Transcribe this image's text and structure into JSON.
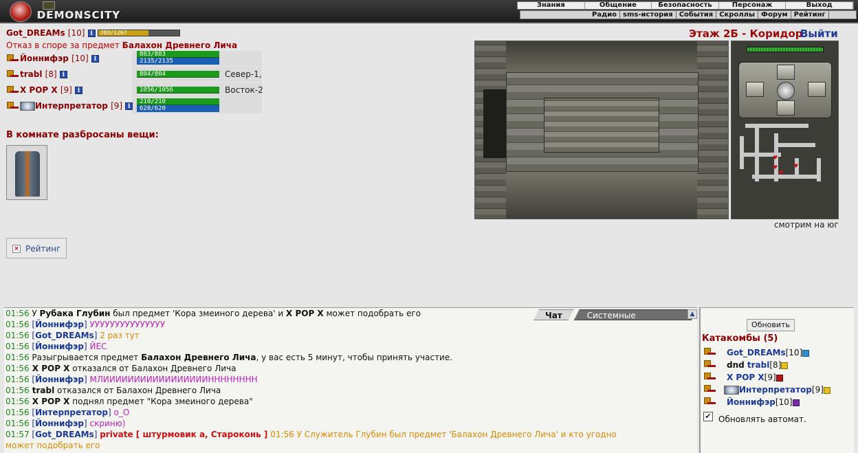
{
  "header": {
    "logo_text": "DEMONSCITY",
    "menu_top": [
      "Знания",
      "Общение",
      "Безопасность",
      "Персонаж",
      "Выход"
    ],
    "menu_bottom": [
      "Радио",
      "sms-история",
      "События",
      "Скроллы",
      "Форум",
      "Рейтинг"
    ]
  },
  "me": {
    "name": "Got_DREAMs",
    "level": "[10]",
    "exp_text": "783/1267",
    "exp_fraction": 0.62
  },
  "refusal": {
    "prefix": "Отказ в споре за предмет",
    "item": "Балахон Древнего Лича"
  },
  "players": [
    {
      "name": "Йоннифэр",
      "level": "[10]",
      "hp": "883/883",
      "mp": "2135/2135",
      "loc": "",
      "avatar": false
    },
    {
      "name": "trabl",
      "level": "[8]",
      "hp": "804/804",
      "mp": "",
      "loc": "Север-1,",
      "avatar": false
    },
    {
      "name": "X POP X",
      "level": "[9]",
      "hp": "1056/1056",
      "mp": "",
      "loc": "Восток-2",
      "avatar": false
    },
    {
      "name": "Интерпретатор",
      "level": "[9]",
      "hp": "210/210",
      "mp": "620/620",
      "loc": "",
      "avatar": true
    }
  ],
  "items_title": "В комнате разбросаны вещи:",
  "rating_button": "Рейтинг",
  "location": {
    "title": "Этаж 2Б - Коридор",
    "exit": "Выйти",
    "look": "смотрим на юг"
  },
  "chat": {
    "tab_chat": "Чат",
    "tab_system": "Системные сообщения",
    "lines": [
      {
        "t": "01:56",
        "parts": [
          [
            "dark",
            " У "
          ],
          [
            "blk",
            "Рубака Глубин"
          ],
          [
            "dark",
            " был предмет 'Кора змеиного дерева' и "
          ],
          [
            "blk",
            "X POP X"
          ],
          [
            "dark",
            " может подобрать его"
          ]
        ]
      },
      {
        "t": "01:56",
        "parts": [
          [
            "br",
            " ["
          ],
          [
            "nm",
            "Йоннифэр"
          ],
          [
            "br",
            "] "
          ],
          [
            "pink",
            "УУУУУУУУУУУУУУУ"
          ]
        ]
      },
      {
        "t": "01:56",
        "parts": [
          [
            "br",
            " ["
          ],
          [
            "nm",
            "Got_DREAMs"
          ],
          [
            "br",
            "] "
          ],
          [
            "orange",
            "2 раз тут"
          ]
        ]
      },
      {
        "t": "01:56",
        "parts": [
          [
            "br",
            " ["
          ],
          [
            "nm",
            "Йоннифэр"
          ],
          [
            "br",
            "] "
          ],
          [
            "pink",
            "ЙЕС"
          ]
        ]
      },
      {
        "t": "01:56",
        "parts": [
          [
            "dark",
            " Разыгрывается предмет "
          ],
          [
            "blk",
            "Балахон Древнего Лича"
          ],
          [
            "dark",
            ", у вас есть 5 минут, чтобы принять участие."
          ]
        ]
      },
      {
        "t": "01:56",
        "parts": [
          [
            "blk",
            " X POP X"
          ],
          [
            "dark",
            " отказался от Балахон Древнего Лича"
          ]
        ]
      },
      {
        "t": "01:56",
        "parts": [
          [
            "br",
            " ["
          ],
          [
            "nm",
            "Йоннифэр"
          ],
          [
            "br",
            "] "
          ],
          [
            "pink",
            "МЛИИИИИИИИИИИИИИИИИНННННННН"
          ]
        ]
      },
      {
        "t": "01:56",
        "parts": [
          [
            "blk",
            " trabl"
          ],
          [
            "dark",
            " отказался от Балахон Древнего Лича"
          ]
        ]
      },
      {
        "t": "01:56",
        "parts": [
          [
            "blk",
            " X POP X"
          ],
          [
            "dark",
            " поднял предмет \"Кора змеиного дерева\""
          ]
        ]
      },
      {
        "t": "01:56",
        "parts": [
          [
            "br",
            " ["
          ],
          [
            "nm",
            "Интерпретатор"
          ],
          [
            "br",
            "] "
          ],
          [
            "pink",
            "о_О"
          ]
        ]
      },
      {
        "t": "01:56",
        "parts": [
          [
            "br",
            " ["
          ],
          [
            "nm",
            "Йоннифэр"
          ],
          [
            "br",
            "] "
          ],
          [
            "pink",
            "скриню)"
          ]
        ]
      },
      {
        "t": "01:57",
        "parts": [
          [
            "br",
            " ["
          ],
          [
            "nm",
            "Got_DREAMs"
          ],
          [
            "br",
            "] "
          ],
          [
            "red",
            "private [ штурмовик а, Староконь ]"
          ],
          [
            "orange",
            " 01:56 У Служитель Глубин был предмет 'Балахон Древнего Лича' и кто угодно"
          ]
        ]
      },
      {
        "t": "",
        "parts": [
          [
            "orange",
            "может подобрать его"
          ]
        ]
      }
    ]
  },
  "userpanel": {
    "refresh": "Обновить",
    "room": "Катакомбы (5)",
    "users": [
      {
        "prefix": "",
        "name": "Got_DREAMs",
        "level": "[10]",
        "icon": "b",
        "avatar": false
      },
      {
        "prefix": "dnd ",
        "name": "trabl",
        "level": "[8]",
        "icon": "y",
        "avatar": false
      },
      {
        "prefix": "",
        "name": "X POP X",
        "level": "[9]",
        "icon": "r",
        "avatar": false
      },
      {
        "prefix": "",
        "name": "Интерпретатор",
        "level": "[9]",
        "icon": "y",
        "avatar": true
      },
      {
        "prefix": "",
        "name": "Йоннифэр",
        "level": "[10]",
        "icon": "p",
        "avatar": false
      }
    ],
    "auto_refresh": "Обновлять автомат.",
    "auto_refresh_checked": true
  }
}
